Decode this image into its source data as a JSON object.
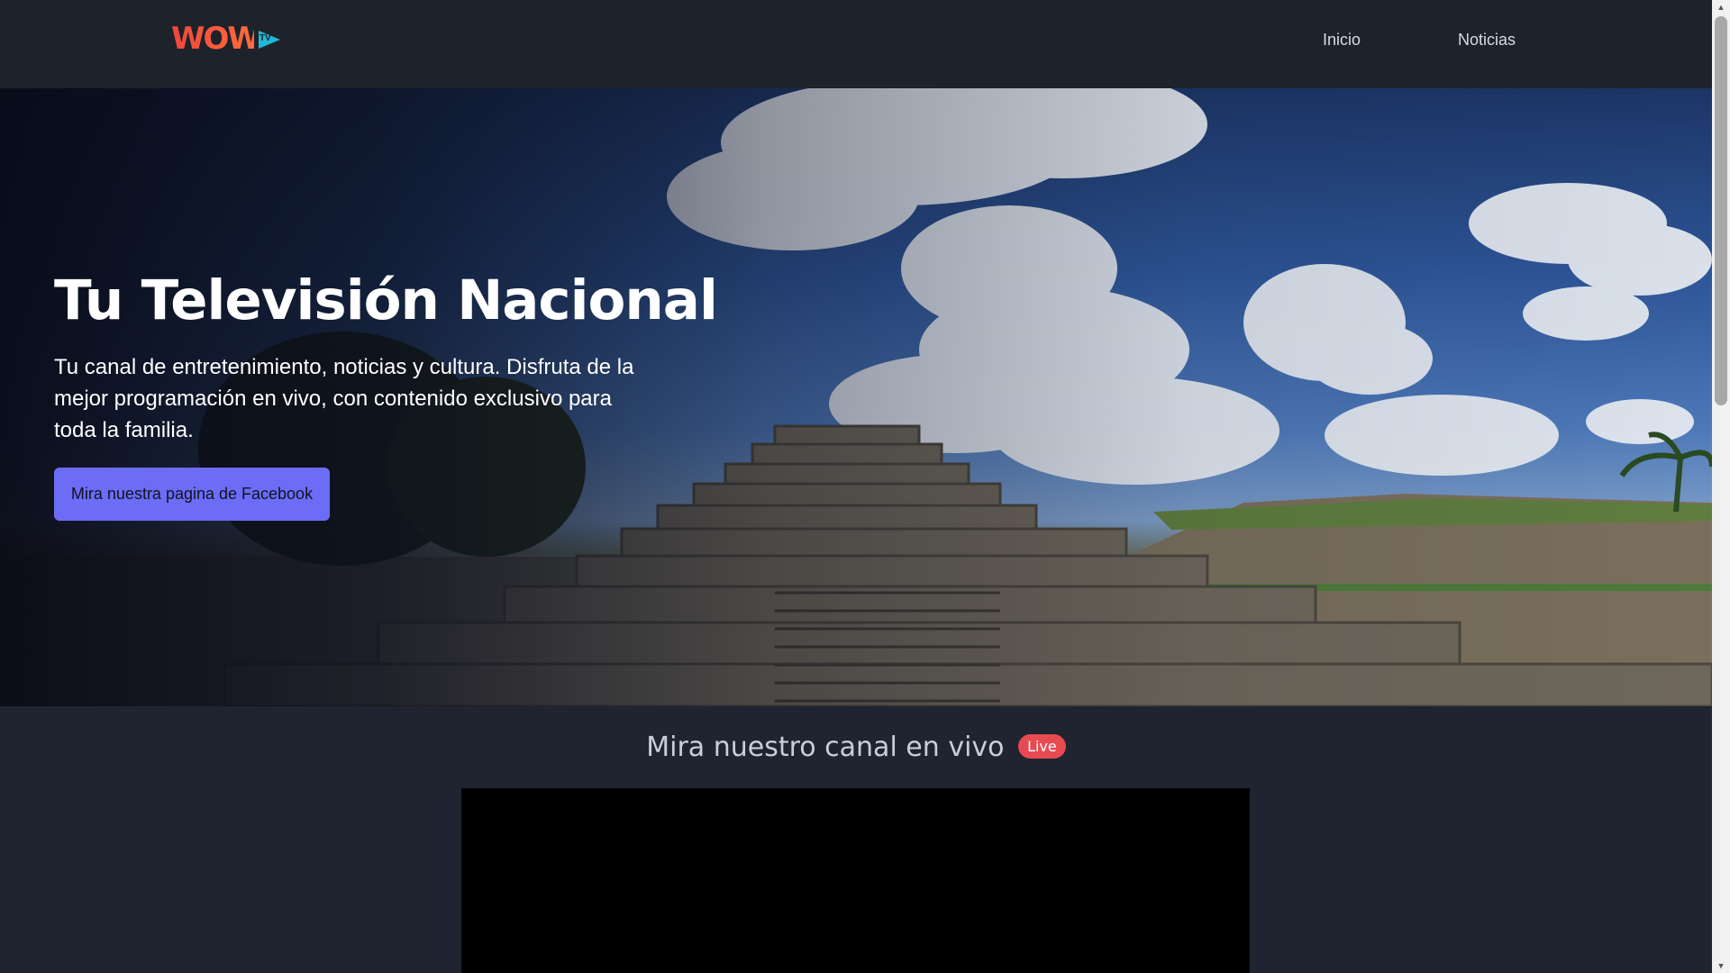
{
  "header": {
    "logo": {
      "word": "WOW",
      "badge": "TV"
    },
    "nav": [
      {
        "label": "Inicio"
      },
      {
        "label": "Noticias"
      }
    ]
  },
  "hero": {
    "title": "Tu Televisión Nacional",
    "description": "Tu canal de entretenimiento, noticias y cultura. Disfruta de la mejor programación en vivo, con contenido exclusivo para toda la familia.",
    "button_label": "Mira nuestra pagina de Facebook",
    "background_image": "pyramid-ruins-under-cloudy-sky"
  },
  "live": {
    "heading": "Mira nuestro canal en vivo",
    "badge": "Live"
  },
  "colors": {
    "accent_button": "#6c6cf6",
    "live_badge": "#e84a52",
    "page_background": "#1f2430",
    "logo_red": "#f0463c",
    "logo_cyan": "#23b7d9"
  },
  "icons": {
    "scroll_up": "scroll-up-arrow-icon",
    "scroll_down": "scroll-down-arrow-icon",
    "logo_play": "play-triangle-icon"
  }
}
